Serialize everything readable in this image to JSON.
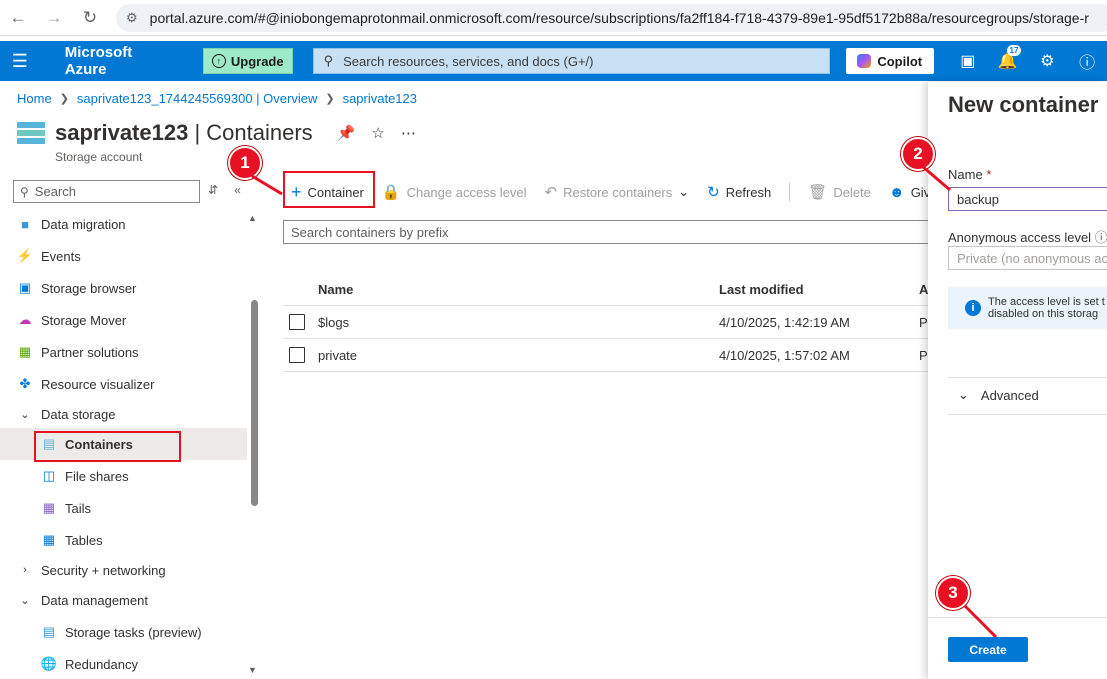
{
  "browser": {
    "url": "portal.azure.com/#@iniobongemaprotonmail.onmicrosoft.com/resource/subscriptions/fa2ff184-f718-4379-89e1-95df5172b88a/resourcegroups/storage-r"
  },
  "topbar": {
    "brand": "Microsoft Azure",
    "upgrade_label": "Upgrade",
    "search_placeholder": "Search resources, services, and docs (G+/)",
    "copilot_label": "Copilot",
    "notification_count": "17"
  },
  "breadcrumb": [
    "Home",
    "saprivate123_1744245569300 | Overview",
    "saprivate123"
  ],
  "page": {
    "title_resource": "saprivate123",
    "title_section": " | Containers",
    "subtitle": "Storage account"
  },
  "sidebar": {
    "search_placeholder": "Search",
    "items": [
      {
        "label": "Data migration",
        "icon": "data-migration-icon",
        "level": 0
      },
      {
        "label": "Events",
        "icon": "events-icon",
        "level": 0
      },
      {
        "label": "Storage browser",
        "icon": "storage-browser-icon",
        "level": 0
      },
      {
        "label": "Storage Mover",
        "icon": "storage-mover-icon",
        "level": 0
      },
      {
        "label": "Partner solutions",
        "icon": "partner-solutions-icon",
        "level": 0
      },
      {
        "label": "Resource visualizer",
        "icon": "resource-visualizer-icon",
        "level": 0
      },
      {
        "label": "Data storage",
        "icon": "chevron-down-icon",
        "level": 0
      },
      {
        "label": "Containers",
        "icon": "containers-icon",
        "level": 1
      },
      {
        "label": "File shares",
        "icon": "file-shares-icon",
        "level": 1
      },
      {
        "label": "Tails",
        "icon": "queues-icon",
        "level": 1
      },
      {
        "label": "Tables",
        "icon": "tables-icon",
        "level": 1
      },
      {
        "label": "Security + networking",
        "icon": "chevron-right-icon",
        "level": 0
      },
      {
        "label": "Data management",
        "icon": "chevron-down-icon",
        "level": 0
      },
      {
        "label": "Storage tasks (preview)",
        "icon": "storage-tasks-icon",
        "level": 1
      },
      {
        "label": "Redundancy",
        "icon": "redundancy-icon",
        "level": 1
      }
    ]
  },
  "toolbar": {
    "add_container": "Container",
    "change_access": "Change access level",
    "restore": "Restore containers",
    "refresh": "Refresh",
    "delete": "Delete",
    "give": "Give"
  },
  "containers": {
    "search_placeholder": "Search containers by prefix",
    "columns": {
      "name": "Name",
      "modified": "Last modified",
      "access": "A"
    },
    "rows": [
      {
        "name": "$logs",
        "modified": "4/10/2025, 1:42:19 AM",
        "access": "P"
      },
      {
        "name": "private",
        "modified": "4/10/2025, 1:57:02 AM",
        "access": "P"
      }
    ]
  },
  "panel": {
    "title": "New container",
    "name_label": "Name",
    "name_required": "*",
    "name_value": "backup",
    "access_label": "Anonymous access level",
    "access_value": "Private (no anonymous access)",
    "info_line1": "The access level is set t",
    "info_line2": "disabled on this storag",
    "advanced_label": "Advanced",
    "create_label": "Create"
  },
  "annotations": [
    "1",
    "2",
    "3"
  ],
  "colors": {
    "accent": "#0078d4",
    "annotation": "#e81123"
  }
}
